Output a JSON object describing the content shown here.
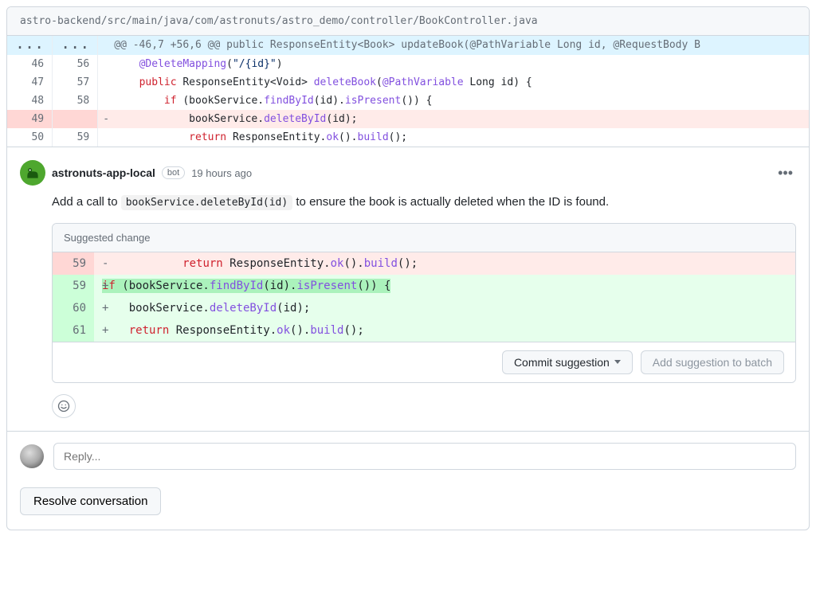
{
  "file_path": "astro-backend/src/main/java/com/astronuts/astro_demo/controller/BookController.java",
  "hunk_header": "@@ -46,7 +56,6 @@ public ResponseEntity<Book> updateBook(@PathVariable Long id, @RequestBody B",
  "diff_lines": [
    {
      "old": "46",
      "new": "56",
      "type": "context",
      "tokens": [
        {
          "t": "    ",
          "c": ""
        },
        {
          "t": "@DeleteMapping",
          "c": "tok-ann"
        },
        {
          "t": "(",
          "c": ""
        },
        {
          "t": "\"/{id}\"",
          "c": "tok-str"
        },
        {
          "t": ")",
          "c": ""
        }
      ]
    },
    {
      "old": "47",
      "new": "57",
      "type": "context",
      "tokens": [
        {
          "t": "    ",
          "c": ""
        },
        {
          "t": "public",
          "c": "tok-keyword"
        },
        {
          "t": " ResponseEntity<Void> ",
          "c": "tok-type"
        },
        {
          "t": "deleteBook",
          "c": "tok-func"
        },
        {
          "t": "(",
          "c": ""
        },
        {
          "t": "@PathVariable",
          "c": "tok-ann"
        },
        {
          "t": " Long id) {",
          "c": ""
        }
      ]
    },
    {
      "old": "48",
      "new": "58",
      "type": "context",
      "tokens": [
        {
          "t": "        ",
          "c": ""
        },
        {
          "t": "if",
          "c": "tok-keyword"
        },
        {
          "t": " (bookService.",
          "c": ""
        },
        {
          "t": "findById",
          "c": "tok-func"
        },
        {
          "t": "(id).",
          "c": ""
        },
        {
          "t": "isPresent",
          "c": "tok-func"
        },
        {
          "t": "()) {",
          "c": ""
        }
      ]
    },
    {
      "old": "49",
      "new": "",
      "type": "del",
      "tokens": [
        {
          "t": "            bookService.",
          "c": ""
        },
        {
          "t": "deleteById",
          "c": "tok-func"
        },
        {
          "t": "(id);",
          "c": ""
        }
      ]
    },
    {
      "old": "50",
      "new": "59",
      "type": "context",
      "tokens": [
        {
          "t": "            ",
          "c": ""
        },
        {
          "t": "return",
          "c": "tok-keyword"
        },
        {
          "t": " ResponseEntity.",
          "c": ""
        },
        {
          "t": "ok",
          "c": "tok-func"
        },
        {
          "t": "().",
          "c": ""
        },
        {
          "t": "build",
          "c": "tok-func"
        },
        {
          "t": "();",
          "c": ""
        }
      ]
    }
  ],
  "comment": {
    "author": "astronuts-app-local",
    "bot_label": "bot",
    "timestamp": "19 hours ago",
    "body_prefix": "Add a call to ",
    "body_code": "bookService.deleteById(id)",
    "body_suffix": " to ensure the book is actually deleted when the ID is found."
  },
  "suggestion": {
    "title": "Suggested change",
    "lines": [
      {
        "num": "59",
        "type": "del",
        "tokens": [
          {
            "t": "            ",
            "c": ""
          },
          {
            "t": "return",
            "c": "tok-keyword"
          },
          {
            "t": " ResponseEntity.",
            "c": ""
          },
          {
            "t": "ok",
            "c": "tok-func"
          },
          {
            "t": "().",
            "c": ""
          },
          {
            "t": "build",
            "c": "tok-func"
          },
          {
            "t": "();",
            "c": ""
          }
        ]
      },
      {
        "num": "59",
        "type": "add",
        "highlight": true,
        "tokens": [
          {
            "t": "if",
            "c": "tok-keyword"
          },
          {
            "t": " (bookService.",
            "c": ""
          },
          {
            "t": "findById",
            "c": "tok-func"
          },
          {
            "t": "(id).",
            "c": ""
          },
          {
            "t": "isPresent",
            "c": "tok-func"
          },
          {
            "t": "()) {",
            "c": ""
          }
        ]
      },
      {
        "num": "60",
        "type": "add",
        "tokens": [
          {
            "t": "    bookService.",
            "c": ""
          },
          {
            "t": "deleteById",
            "c": "tok-func"
          },
          {
            "t": "(id);",
            "c": ""
          }
        ]
      },
      {
        "num": "61",
        "type": "add",
        "tokens": [
          {
            "t": "    ",
            "c": ""
          },
          {
            "t": "return",
            "c": "tok-keyword"
          },
          {
            "t": " ResponseEntity.",
            "c": ""
          },
          {
            "t": "ok",
            "c": "tok-func"
          },
          {
            "t": "().",
            "c": ""
          },
          {
            "t": "build",
            "c": "tok-func"
          },
          {
            "t": "();",
            "c": ""
          }
        ]
      }
    ],
    "commit_button": "Commit suggestion",
    "batch_button": "Add suggestion to batch"
  },
  "reply_placeholder": "Reply...",
  "resolve_button": "Resolve conversation",
  "ellipsis": "..."
}
